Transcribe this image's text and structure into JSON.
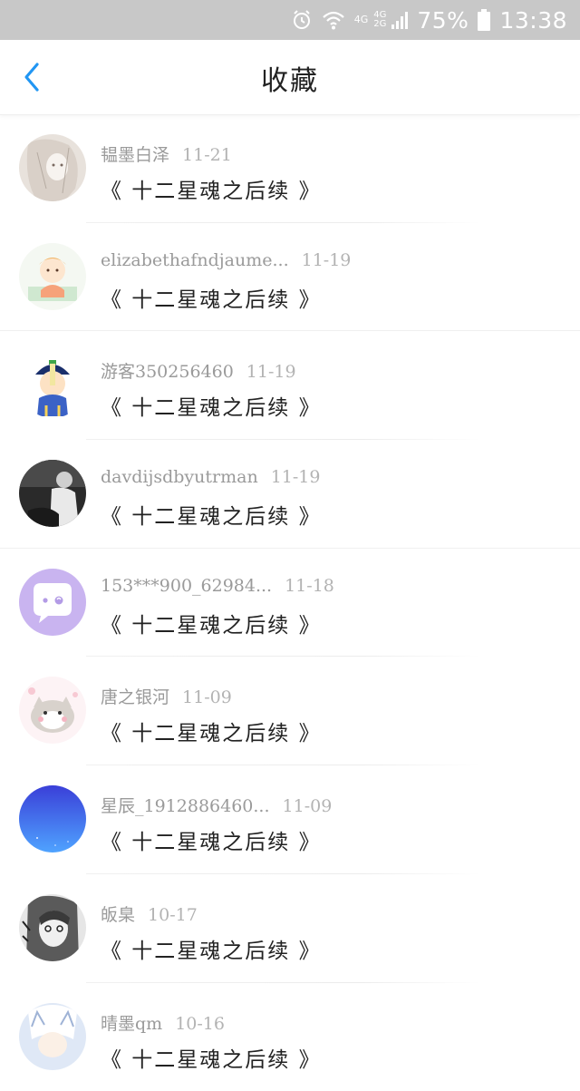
{
  "status_bar": {
    "network_top": "4G",
    "network_bottom": "2G",
    "network_extra": "4G",
    "battery": "75%",
    "time": "13:38"
  },
  "header": {
    "title": "收藏"
  },
  "items": [
    {
      "name": "韫墨白泽",
      "date": "11-21",
      "title": "《 十二星魂之后续 》"
    },
    {
      "name": "elizabethafndjaume...",
      "date": "11-19",
      "title": "《 十二星魂之后续 》"
    },
    {
      "name": "游客350256460",
      "date": "11-19",
      "title": "《 十二星魂之后续 》"
    },
    {
      "name": "davdijsdbyutrman",
      "date": "11-19",
      "title": "《 十二星魂之后续 》"
    },
    {
      "name": "153***900_62984...",
      "date": "11-18",
      "title": "《 十二星魂之后续 》"
    },
    {
      "name": "唐之银河",
      "date": "11-09",
      "title": "《 十二星魂之后续 》"
    },
    {
      "name": "星辰_1912886460...",
      "date": "11-09",
      "title": "《 十二星魂之后续 》"
    },
    {
      "name": "皈臬",
      "date": "10-17",
      "title": "《 十二星魂之后续 》"
    },
    {
      "name": "晴墨qm",
      "date": "10-16",
      "title": "《 十二星魂之后续 》"
    }
  ],
  "colors": {
    "accent": "#2196f3",
    "status_bar_bg": "#c8c8c8",
    "meta_text": "#9a9a9a",
    "title_text": "#222222"
  }
}
